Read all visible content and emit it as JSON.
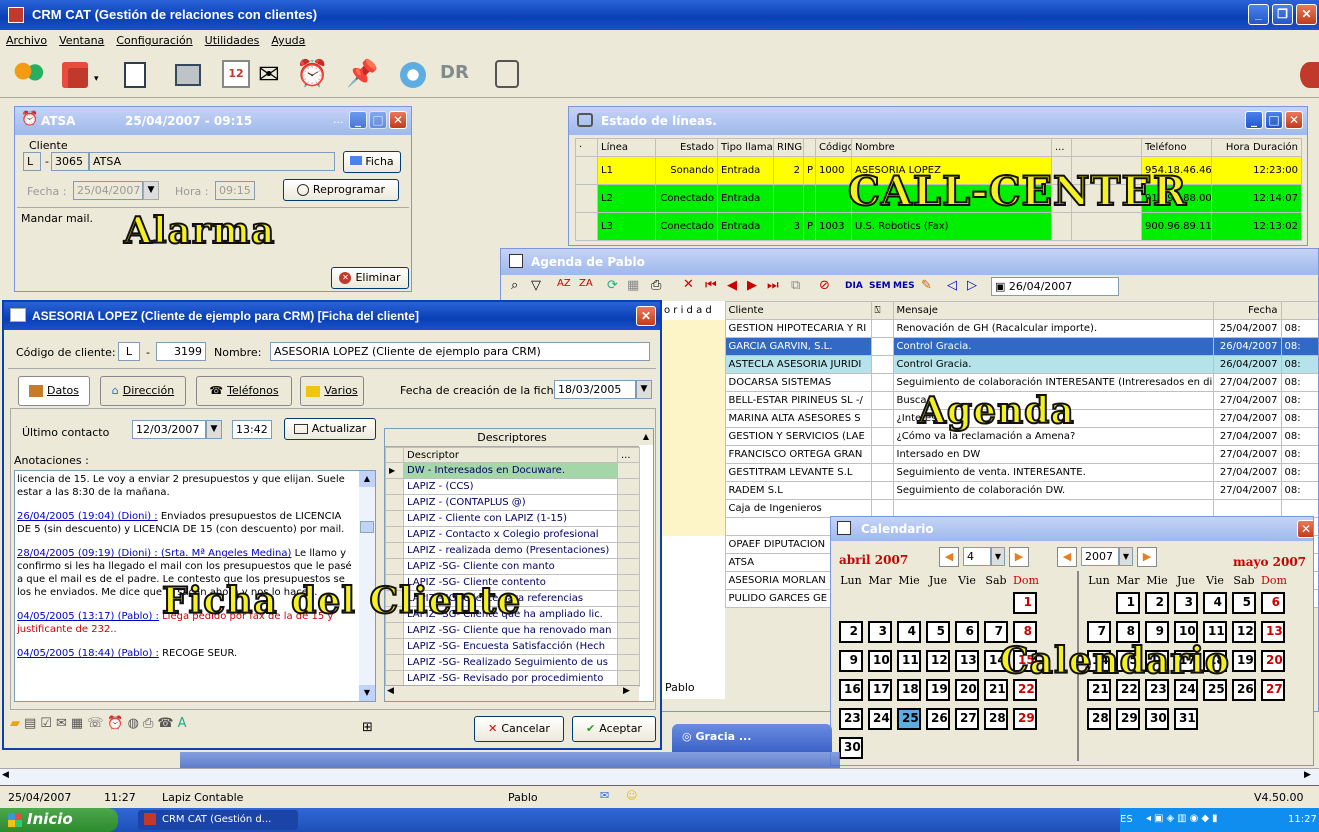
{
  "app": {
    "title": "CRM CAT (Gestión de relaciones con clientes)",
    "icon": "crm-app-icon"
  },
  "menu": [
    "Archivo",
    "Ventana",
    "Configuración",
    "Utilidades",
    "Ayuda"
  ],
  "toolbar": [
    "users-icon",
    "cube-icon",
    "task-icon",
    "folder-icon",
    "calendar-icon",
    "mail-icon",
    "alarm-clock-icon",
    "pushpin-icon",
    "gear-icon",
    "dr-icon",
    "phone-icon"
  ],
  "alarma": {
    "title": "ATSA",
    "datetime": "25/04/2007 - 09:15",
    "cliente_label": "Cliente",
    "cliente_code": "L",
    "cliente_num": "3065",
    "cliente_name": "ATSA",
    "ficha_btn": "Ficha",
    "fecha_label": "Fecha :",
    "fecha_value": "25/04/2007",
    "hora_label": "Hora :",
    "hora_value": "09:15",
    "reprogramar_btn": "Reprogramar",
    "note": "Mandar mail.",
    "eliminar_btn": "Eliminar",
    "watermark": "Alarma"
  },
  "estado": {
    "title": "Estado de líneas.",
    "headers": [
      "Línea",
      "Estado",
      "Tipo llamada",
      "RING",
      "Código",
      "Nombre",
      "...",
      "Teléfono",
      "Hora",
      "Duración"
    ],
    "rows": [
      {
        "linea": "L1",
        "estado": "Sonando",
        "tipo": "Entrada",
        "ring": "2",
        "p": "P",
        "codigo": "1000",
        "nombre": "ASESORIA LOPEZ",
        "telefono": "954.18.46.46",
        "duracion": "12:23:00",
        "color": "#ffff00"
      },
      {
        "linea": "L2",
        "estado": "Conectado",
        "tipo": "Entrada",
        "ring": "",
        "p": "",
        "codigo": "",
        "nombre": "",
        "telefono": "914.99.88.00",
        "duracion": "12:14:07",
        "color": "#00ee00"
      },
      {
        "linea": "L3",
        "estado": "Conectado",
        "tipo": "Entrada",
        "ring": "3",
        "p": "P",
        "codigo": "1003",
        "nombre": "U.S. Robotics (Fax)",
        "telefono": "900.96.89.11",
        "duracion": "12:13:02",
        "color": "#00ee00"
      }
    ],
    "watermark": "CALL-CENTER"
  },
  "agenda": {
    "title": "Agenda de Pablo",
    "view_tabs": [
      "DIA",
      "SEM",
      "MES"
    ],
    "date": "26/04/2007",
    "headers": [
      "o r i d a d",
      "Cliente",
      "Mensaje",
      "Fecha"
    ],
    "rows": [
      {
        "cliente": "GESTION HIPOTECARIA Y RI",
        "mensaje": "Renovación de GH (Racalcular importe).",
        "fecha": "25/04/2007",
        "hora": "08:"
      },
      {
        "cliente": "GARCIA GARVIN, S.L.",
        "mensaje": "Control Gracia.",
        "fecha": "26/04/2007",
        "hora": "08:",
        "sel": "sel"
      },
      {
        "cliente": "ASTECLA ASESORIA JURIDI",
        "mensaje": "Control Gracia.",
        "fecha": "26/04/2007",
        "hora": "08:",
        "sel": "hl"
      },
      {
        "cliente": "DOCARSA SISTEMAS",
        "mensaje": "Seguimiento de colaboración INTERESANTE (Intreresados en di",
        "fecha": "27/04/2007",
        "hora": "08:"
      },
      {
        "cliente": "BELL-ESTAR PIRINEUS SL -/",
        "mensaje": "Busca",
        "fecha": "27/04/2007",
        "hora": "08:"
      },
      {
        "cliente": "MARINA ALTA ASESORES S",
        "mensaje": "¿Interesa",
        "fecha": "27/04/2007",
        "hora": "08:"
      },
      {
        "cliente": "GESTION Y SERVICIOS (LAE",
        "mensaje": "¿Cómo va la reclamación a Amena?",
        "fecha": "27/04/2007",
        "hora": "08:"
      },
      {
        "cliente": "FRANCISCO ORTEGA GRAN",
        "mensaje": "Intersado en DW",
        "fecha": "27/04/2007",
        "hora": "08:"
      },
      {
        "cliente": "GESTITRAM LEVANTE S.L",
        "mensaje": "Seguimiento de venta. INTERESANTE.",
        "fecha": "27/04/2007",
        "hora": "08:"
      },
      {
        "cliente": "RADEM S.L",
        "mensaje": "Seguimiento de colaboración DW.",
        "fecha": "27/04/2007",
        "hora": "08:"
      },
      {
        "cliente": "Caja de Ingenieros",
        "mensaje": "",
        "fecha": "",
        "hora": ""
      },
      {
        "cliente": "",
        "mensaje": "",
        "fecha": "",
        "hora": ""
      },
      {
        "cliente": "OPAEF DIPUTACION",
        "mensaje": "",
        "fecha": "",
        "hora": ""
      },
      {
        "cliente": "ATSA",
        "mensaje": "",
        "fecha": "",
        "hora": ""
      },
      {
        "cliente": "ASESORIA MORLAN",
        "mensaje": "",
        "fecha": "",
        "hora": ""
      },
      {
        "cliente": "PULIDO GARCES GE",
        "mensaje": "",
        "fecha": "",
        "hora": ""
      }
    ],
    "footer_user": "Pablo",
    "watermark": "Agenda"
  },
  "ficha": {
    "title": "ASESORIA LOPEZ (Cliente de ejemplo para CRM) [Ficha del cliente]",
    "codigo_label": "Código de cliente:",
    "codigo_l": "L",
    "codigo_num": "3199",
    "nombre_label": "Nombre:",
    "nombre_value": "ASESORIA LOPEZ (Cliente de ejemplo para CRM)",
    "tabs": [
      "Datos",
      "Dirección",
      "Teléfonos",
      "Varios"
    ],
    "fecha_creacion_label": "Fecha de creación de la ficha:",
    "fecha_creacion": "18/03/2005",
    "ultimo_label": "Último contacto",
    "ultimo_fecha": "12/03/2007",
    "ultimo_hora": "13:42",
    "actualizar_btn": "Actualizar",
    "anot_label": "Anotaciones :",
    "notes": [
      {
        "t": "licencia de 15. Le voy a enviar 2 presupuestos y que elijan. Suele estar a las 8:30 de la mañana.",
        "c": "#000"
      },
      {
        "h": "26/04/2005  (19:04) (Dioni) :",
        "t": " Enviados presupuestos de LICENCIA DE 5 (sin descuento) y LICENCIA DE 15 (con descuento) por mail.",
        "c": "#000"
      },
      {
        "h": "28/04/2005  (09:19) (Dioni) :",
        "h2": " (Srta. Mª Angeles Medina)",
        "t": " Le llamo y  confirmo si les ha llegado el mail con los presupuestos que le pasé a que el mail es de el padre. Le contesto que los presupuestos se los he enviados. Me dice que lo sacan ahora y nos lo hacen.",
        "c": "#000"
      },
      {
        "h": "04/05/2005  (13:17) (Pablo) :",
        "t": " Llega pedido por fax de la de 15 y justificante de 232..",
        "c": "#d00000"
      },
      {
        "h": "04/05/2005  (18:44) (Pablo) :",
        "t": " RECOGE SEUR.",
        "c": "#000"
      }
    ],
    "desc_header": "Descriptores",
    "desc_col": "Descriptor",
    "descriptores": [
      "DW - Interesados en Docuware.",
      "LAPIZ - (CCS)",
      "LAPIZ - (CONTAPLUS @)",
      "LAPIZ - Cliente con LAPIZ (1-15)",
      "LAPIZ - Contacto x Colegio profesional",
      "LAPIZ - realizada demo (Presentaciones)",
      "LAPIZ -SG- Cliente con manto",
      "LAPIZ -SG- Cliente contento",
      "LAPIZ -SG- Cliente para referencias",
      "LAPIZ -SG- Cliente que ha ampliado lic.",
      "LAPIZ -SG- Cliente que ha renovado man",
      "LAPIZ -SG- Encuesta Satisfacción (Hech",
      "LAPIZ -SG- Realizado Seguimiento de us",
      "LAPIZ -SG- Revisado por procedimiento"
    ],
    "cancelar_btn": "Cancelar",
    "aceptar_btn": "Aceptar",
    "watermark": "Ficha del Cliente"
  },
  "calendario": {
    "title": "Calendario",
    "left_month": "abril 2007",
    "right_month": "mayo 2007",
    "spin_month": "4",
    "spin_year": "2007",
    "weekdays": [
      "Lun",
      "Mar",
      "Mie",
      "Jue",
      "Vie",
      "Sab",
      "Dom"
    ],
    "april": [
      [
        "",
        "",
        "",
        "",
        "",
        "",
        "1"
      ],
      [
        "2",
        "3",
        "4",
        "5",
        "6",
        "7",
        "8"
      ],
      [
        "9",
        "10",
        "11",
        "12",
        "13",
        "14",
        "15"
      ],
      [
        "16",
        "17",
        "18",
        "19",
        "20",
        "21",
        "22"
      ],
      [
        "23",
        "24",
        "25",
        "26",
        "27",
        "28",
        "29"
      ],
      [
        "30",
        "",
        "",
        "",
        "",
        "",
        ""
      ]
    ],
    "may": [
      [
        "",
        "1",
        "2",
        "3",
        "4",
        "5",
        "6"
      ],
      [
        "7",
        "8",
        "9",
        "10",
        "11",
        "12",
        "13"
      ],
      [
        "14",
        "15",
        "16",
        "17",
        "18",
        "19",
        "20"
      ],
      [
        "21",
        "22",
        "23",
        "24",
        "25",
        "26",
        "27"
      ],
      [
        "28",
        "29",
        "30",
        "31",
        "",
        "",
        ""
      ]
    ],
    "today": "25",
    "watermark": "Calendario"
  },
  "taskbar_windows": [
    {
      "label": "Gracia ..."
    }
  ],
  "status": {
    "date": "25/04/2007",
    "time": "11:27",
    "company": "Lapiz Contable",
    "user": "Pablo",
    "version": "V4.50.00"
  },
  "winbar": {
    "start": "Inicio",
    "task": "CRM CAT (Gestión d...",
    "lang": "ES",
    "clock": "11:27"
  },
  "colors": {
    "title_blue": "#0a3fb5",
    "row_yellow": "#ffff00",
    "row_green": "#00ee00",
    "watermark_yellow": "#f5f021",
    "select_blue": "#316ac5"
  }
}
